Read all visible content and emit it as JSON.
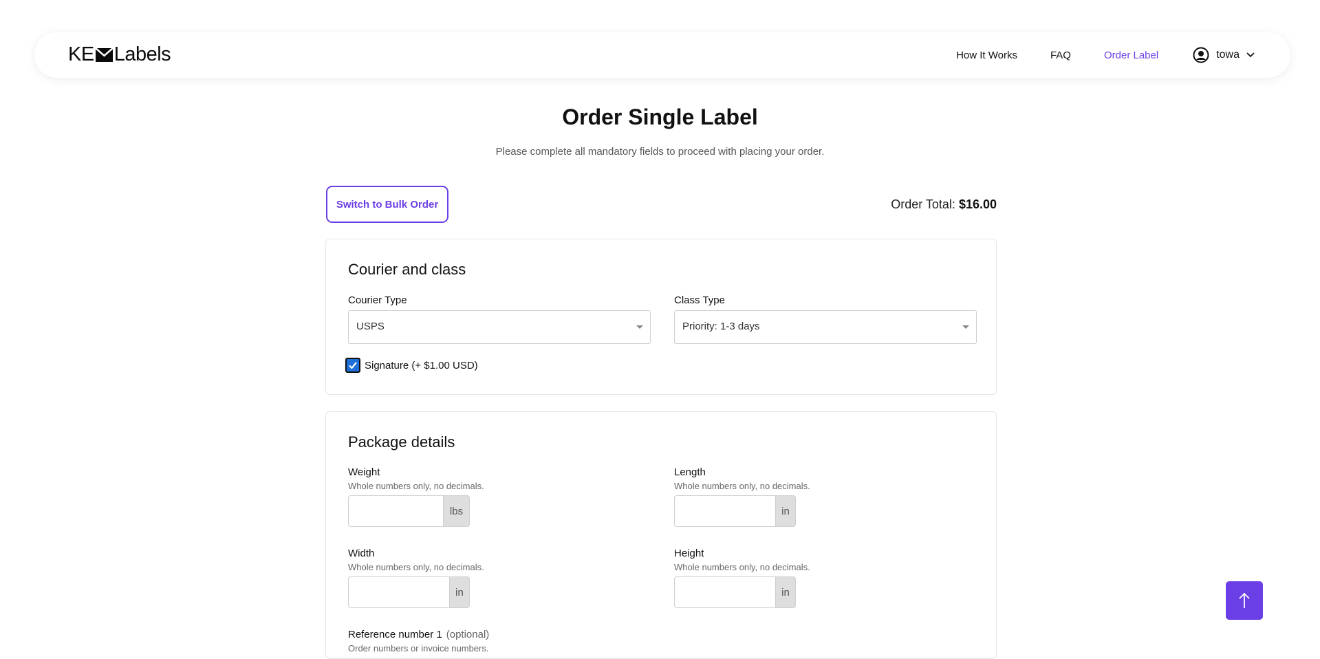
{
  "header": {
    "logo_left": "KE",
    "logo_right": "Labels",
    "nav": {
      "how_it_works": "How It Works",
      "faq": "FAQ",
      "order_label": "Order Label"
    },
    "user": {
      "name": "towa"
    }
  },
  "page": {
    "title": "Order Single Label",
    "subtitle": "Please complete all mandatory fields to proceed with placing your order.",
    "bulk_button": "Switch to Bulk Order",
    "order_total_label": "Order Total:",
    "order_total_value": "$16.00"
  },
  "courier_section": {
    "title": "Courier and class",
    "courier_type_label": "Courier Type",
    "courier_type_value": "USPS",
    "class_type_label": "Class Type",
    "class_type_value": "Priority: 1-3 days",
    "signature_label": "Signature (+ $1.00 USD)",
    "signature_checked": true
  },
  "package_section": {
    "title": "Package details",
    "weight": {
      "label": "Weight",
      "hint": "Whole numbers only, no decimals.",
      "unit": "lbs",
      "value": ""
    },
    "length": {
      "label": "Length",
      "hint": "Whole numbers only, no decimals.",
      "unit": "in",
      "value": ""
    },
    "width": {
      "label": "Width",
      "hint": "Whole numbers only, no decimals.",
      "unit": "in",
      "value": ""
    },
    "height": {
      "label": "Height",
      "hint": "Whole numbers only, no decimals.",
      "unit": "in",
      "value": ""
    },
    "reference1": {
      "label": "Reference number 1",
      "optional": "(optional)",
      "hint": "Order numbers or invoice numbers."
    }
  },
  "colors": {
    "accent": "#6b3fe6",
    "checkbox": "#1e6fd9"
  },
  "icons": {
    "logo_mark": "envelope-icon",
    "user": "user-circle-icon",
    "user_menu_chevron": "chevron-down-icon",
    "select_caret": "caret-down-icon",
    "checkbox_check": "check-icon",
    "scroll_top": "arrow-up-icon"
  }
}
